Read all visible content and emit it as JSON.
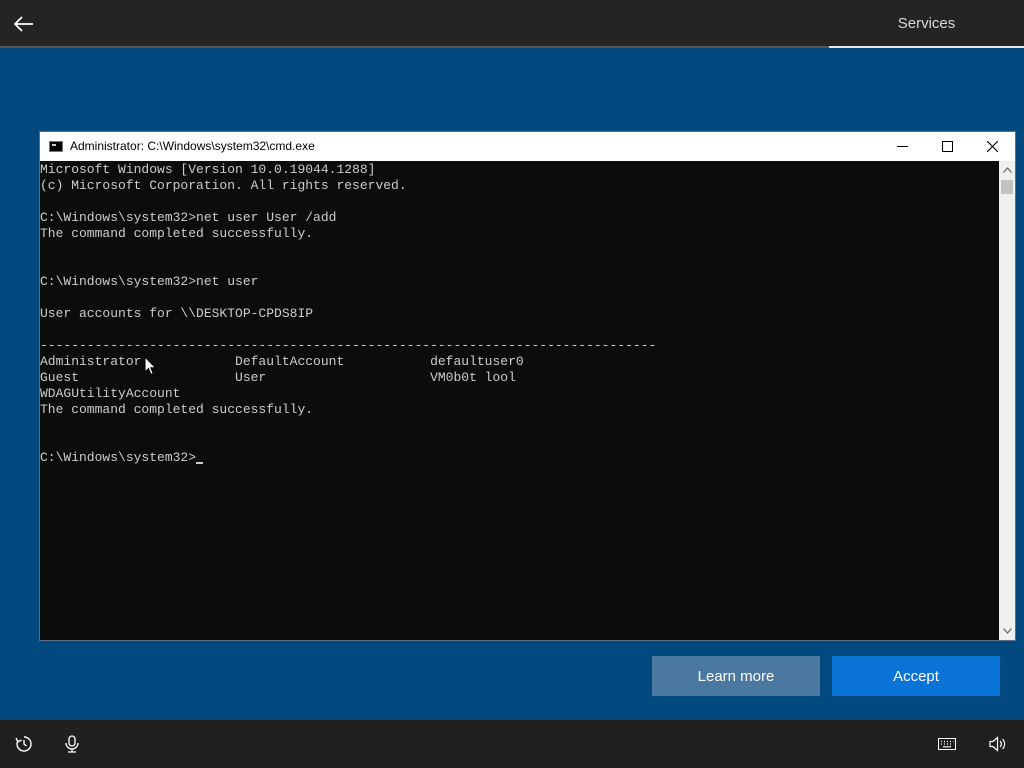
{
  "header": {
    "back_icon": "arrow-left-icon",
    "section_tab": "Services"
  },
  "window": {
    "title": "Administrator: C:\\Windows\\system32\\cmd.exe",
    "icon": "console-icon",
    "controls": [
      "minimize-icon",
      "maximize-icon",
      "close-icon"
    ]
  },
  "console": {
    "lines": [
      "Microsoft Windows [Version 10.0.19044.1288]",
      "(c) Microsoft Corporation. All rights reserved.",
      "",
      "C:\\Windows\\system32>net user User /add",
      "The command completed successfully.",
      "",
      "",
      "C:\\Windows\\system32>net user",
      "",
      "User accounts for \\\\DESKTOP-CPDS8IP",
      "",
      "-------------------------------------------------------------------------------",
      "Administrator            DefaultAccount           defaultuser0",
      "Guest                    User                     VM0b0t lool",
      "WDAGUtilityAccount",
      "The command completed successfully.",
      "",
      "",
      "C:\\Windows\\system32>"
    ]
  },
  "buttons": {
    "learn_more": "Learn more",
    "accept": "Accept"
  },
  "bottombar": {
    "left_icons": [
      "ease-of-access-icon",
      "microphone-icon"
    ],
    "right_icons": [
      "keyboard-icon",
      "volume-icon"
    ]
  },
  "colors": {
    "background": "#02497f",
    "topbar": "#242424",
    "accept": "#0a74d6",
    "learn_more": "#4b78a0",
    "console_bg": "#0c0c0c",
    "console_text": "#cccccc"
  }
}
